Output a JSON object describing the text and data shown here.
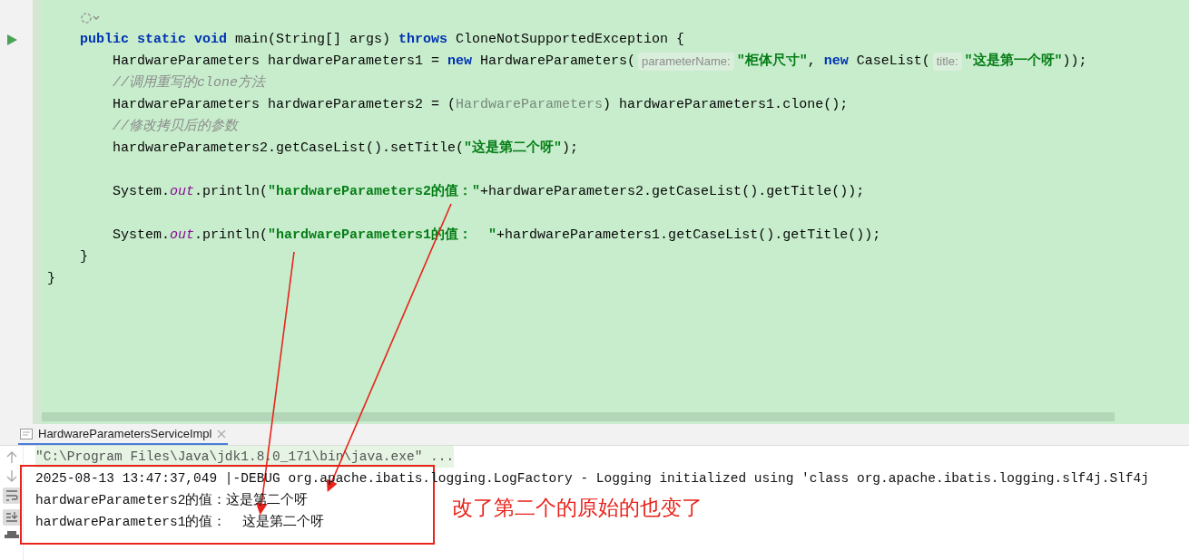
{
  "editor": {
    "lines": [
      {
        "kind": "group",
        "children": [
          {
            "kind": "inlay"
          },
          {
            "kind": "code",
            "segments": [
              {
                "kind": "kw",
                "text": "public static void"
              },
              {
                "kind": "plain",
                "text": " main(String[] args) "
              },
              {
                "kind": "kw",
                "text": "throws"
              },
              {
                "kind": "plain",
                "text": " CloneNotSupportedException {"
              }
            ]
          },
          {
            "kind": "group",
            "children": [
              {
                "kind": "code",
                "segments": [
                  {
                    "kind": "plain",
                    "text": "HardwareParameters hardwareParameters1 = "
                  },
                  {
                    "kind": "kw",
                    "text": "new"
                  },
                  {
                    "kind": "plain",
                    "text": " HardwareParameters("
                  },
                  {
                    "kind": "hint",
                    "text": "parameterName:"
                  },
                  {
                    "kind": "str",
                    "text": "\"柜体尺寸\""
                  },
                  {
                    "kind": "plain",
                    "text": ", "
                  },
                  {
                    "kind": "kw",
                    "text": "new"
                  },
                  {
                    "kind": "plain",
                    "text": " CaseList("
                  },
                  {
                    "kind": "hint",
                    "text": "title:"
                  },
                  {
                    "kind": "str",
                    "text": "\"这是第一个呀\""
                  },
                  {
                    "kind": "plain",
                    "text": "));"
                  }
                ]
              },
              {
                "kind": "code",
                "segments": [
                  {
                    "kind": "comment",
                    "text": "//调用重写的clone方法"
                  }
                ]
              },
              {
                "kind": "code",
                "segments": [
                  {
                    "kind": "plain",
                    "text": "HardwareParameters hardwareParameters2 = ("
                  },
                  {
                    "kind": "cast",
                    "text": "HardwareParameters"
                  },
                  {
                    "kind": "plain",
                    "text": ") hardwareParameters1.clone();"
                  }
                ]
              },
              {
                "kind": "code",
                "segments": [
                  {
                    "kind": "comment",
                    "text": "//修改拷贝后的参数"
                  }
                ]
              },
              {
                "kind": "code",
                "segments": [
                  {
                    "kind": "plain",
                    "text": "hardwareParameters2.getCaseList().setTitle("
                  },
                  {
                    "kind": "str",
                    "text": "\"这是第二个呀\""
                  },
                  {
                    "kind": "plain",
                    "text": ");"
                  }
                ]
              },
              {
                "kind": "blank"
              },
              {
                "kind": "code",
                "segments": [
                  {
                    "kind": "plain",
                    "text": "System."
                  },
                  {
                    "kind": "field",
                    "text": "out"
                  },
                  {
                    "kind": "plain",
                    "text": ".println("
                  },
                  {
                    "kind": "str",
                    "text": "\"hardwareParameters2的值：\""
                  },
                  {
                    "kind": "plain",
                    "text": "+hardwareParameters2.getCaseList().getTitle());"
                  }
                ]
              },
              {
                "kind": "blank"
              },
              {
                "kind": "code",
                "segments": [
                  {
                    "kind": "plain",
                    "text": "System."
                  },
                  {
                    "kind": "field",
                    "text": "out"
                  },
                  {
                    "kind": "plain",
                    "text": ".println("
                  },
                  {
                    "kind": "str",
                    "text": "\"hardwareParameters1的值：  \""
                  },
                  {
                    "kind": "plain",
                    "text": "+hardwareParameters1.getCaseList().getTitle());"
                  }
                ]
              }
            ]
          },
          {
            "kind": "code",
            "segments": [
              {
                "kind": "plain",
                "text": "}"
              }
            ]
          }
        ]
      },
      {
        "kind": "code",
        "segments": [
          {
            "kind": "plain",
            "text": "}"
          }
        ]
      }
    ]
  },
  "console": {
    "tabs": [
      {
        "label": "HardwareParametersServiceImpl",
        "selected": true
      }
    ],
    "lines": [
      {
        "kind": "command",
        "text": "\"C:\\Program Files\\Java\\jdk1.8.0_171\\bin\\java.exe\" ..."
      },
      {
        "kind": "output",
        "text": "2025-08-13 13:47:37,049 |-DEBUG org.apache.ibatis.logging.LogFactory - Logging initialized using 'class org.apache.ibatis.logging.slf4j.Slf4j"
      },
      {
        "kind": "output",
        "text": "hardwareParameters2的值：这是第二个呀"
      },
      {
        "kind": "output",
        "text": "hardwareParameters1的值：  这是第二个呀"
      }
    ]
  },
  "annotation": {
    "text": "改了第二个的原始的也变了"
  }
}
